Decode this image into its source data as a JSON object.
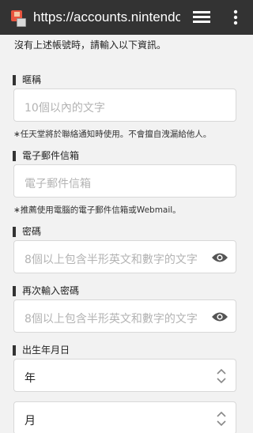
{
  "browser": {
    "url": "https://accounts.nintendo",
    "tabs_icon": "tabs-icon",
    "menu_icon": "overflow-menu-icon"
  },
  "form": {
    "intro": "沒有上述帳號時，請輸入以下資訊。",
    "nickname": {
      "label": "暱稱",
      "placeholder": "10個以內的文字",
      "note": "∗任天堂將於聯絡通知時使用。不會擅自洩漏給他人。"
    },
    "email": {
      "label": "電子郵件信箱",
      "placeholder": "電子郵件信箱",
      "note": "∗推薦使用電腦的電子郵件信箱或Webmail。"
    },
    "password": {
      "label": "密碼",
      "placeholder": "8個以上包含半形英文和數字的文字"
    },
    "password_confirm": {
      "label": "再次輸入密碼",
      "placeholder": "8個以上包含半形英文和數字的文字"
    },
    "birthdate": {
      "label": "出生年月日",
      "year": "年",
      "month": "月"
    }
  }
}
